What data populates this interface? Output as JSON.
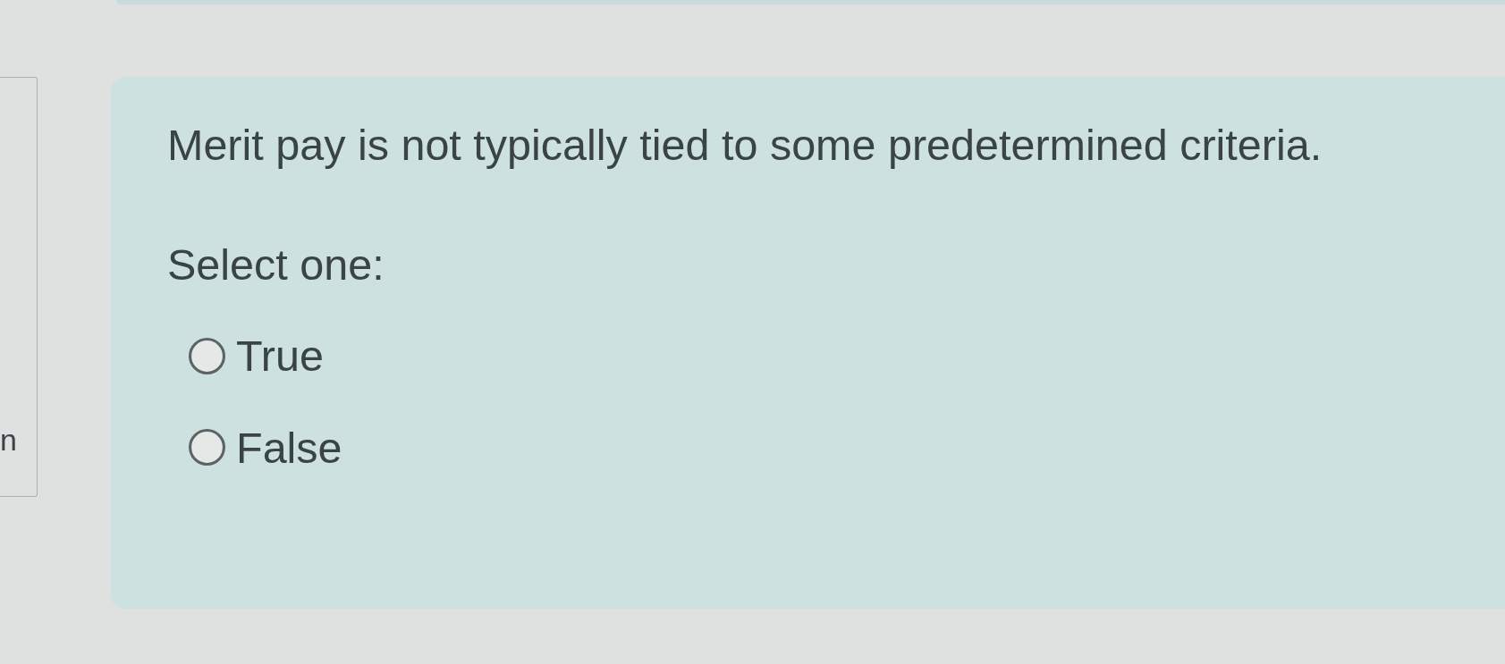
{
  "side_panel": {
    "text": "n"
  },
  "question": {
    "text": "Merit pay is not typically tied to some predetermined criteria.",
    "prompt": "Select one:",
    "options": [
      {
        "label": "True",
        "selected": false
      },
      {
        "label": "False",
        "selected": false
      }
    ]
  }
}
